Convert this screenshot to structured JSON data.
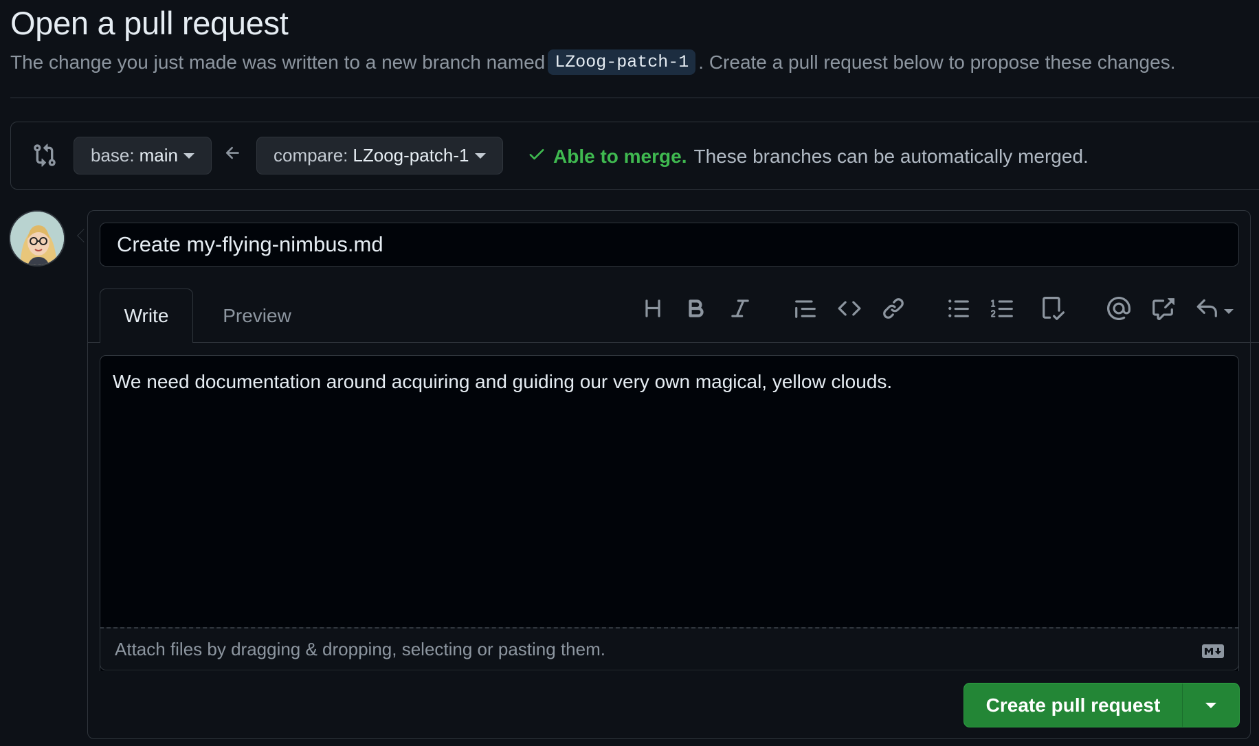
{
  "header": {
    "title": "Open a pull request",
    "subtitle_before": "The change you just made was written to a new branch named",
    "branch": "LZoog-patch-1",
    "subtitle_after": ". Create a pull request below to propose these changes."
  },
  "compare": {
    "base_label": "base:",
    "base_value": "main",
    "compare_label": "compare:",
    "compare_value": "LZoog-patch-1",
    "merge_ok": "Able to merge.",
    "merge_desc": "These branches can be automatically merged."
  },
  "form": {
    "title_value": "Create my-flying-nimbus.md",
    "tabs": [
      "Write",
      "Preview"
    ],
    "body_value": "We need documentation around acquiring and guiding our very own magical, yellow clouds.",
    "attach_hint": "Attach files by dragging & dropping, selecting or pasting them.",
    "submit_label": "Create pull request"
  },
  "toolbar_icons": [
    "heading-icon",
    "bold-icon",
    "italic-icon",
    "quote-icon",
    "code-icon",
    "link-icon",
    "bulleted-list-icon",
    "numbered-list-icon",
    "task-list-icon",
    "mention-icon",
    "cross-reference-icon",
    "reply-icon"
  ],
  "colors": {
    "background": "#0d1117",
    "border": "#30363d",
    "success": "#3fb950",
    "primary_button": "#238636",
    "text": "#e6edf3",
    "muted": "#8d96a0"
  }
}
